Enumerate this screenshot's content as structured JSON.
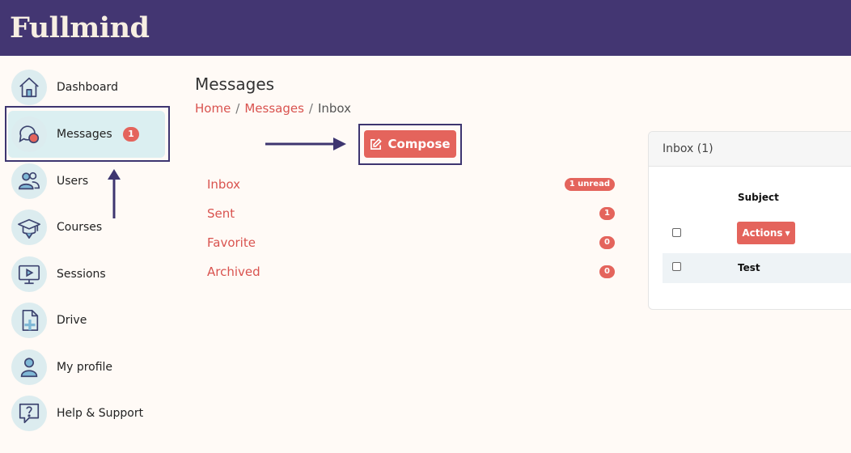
{
  "app": {
    "logo_text": "Fullmind"
  },
  "sidebar": {
    "items": [
      {
        "label": "Dashboard",
        "icon": "home-icon"
      },
      {
        "label": "Messages",
        "icon": "chat-bubbles-icon",
        "badge": "1",
        "active": true
      },
      {
        "label": "Users",
        "icon": "users-icon"
      },
      {
        "label": "Courses",
        "icon": "graduation-cap-icon"
      },
      {
        "label": "Sessions",
        "icon": "monitor-play-icon"
      },
      {
        "label": "Drive",
        "icon": "file-plus-icon"
      },
      {
        "label": "My profile",
        "icon": "user-icon"
      },
      {
        "label": "Help & Support",
        "icon": "help-chat-icon"
      }
    ]
  },
  "page": {
    "title": "Messages",
    "breadcrumb": [
      "Home",
      "Messages",
      "Inbox"
    ],
    "separator": "/"
  },
  "compose": {
    "label": "Compose",
    "icon": "edit-icon"
  },
  "folders": [
    {
      "name": "Inbox",
      "badge": "1 unread"
    },
    {
      "name": "Sent",
      "badge": "1"
    },
    {
      "name": "Favorite",
      "badge": "0"
    },
    {
      "name": "Archived",
      "badge": "0"
    }
  ],
  "inbox": {
    "header": "Inbox (1)",
    "column_subject": "Subject",
    "actions_label": "Actions",
    "rows": [
      {
        "subject": "Test"
      }
    ]
  },
  "colors": {
    "topbar": "#433672",
    "accent": "#e4645c",
    "link": "#d9534f",
    "highlight": "#3d3570"
  }
}
